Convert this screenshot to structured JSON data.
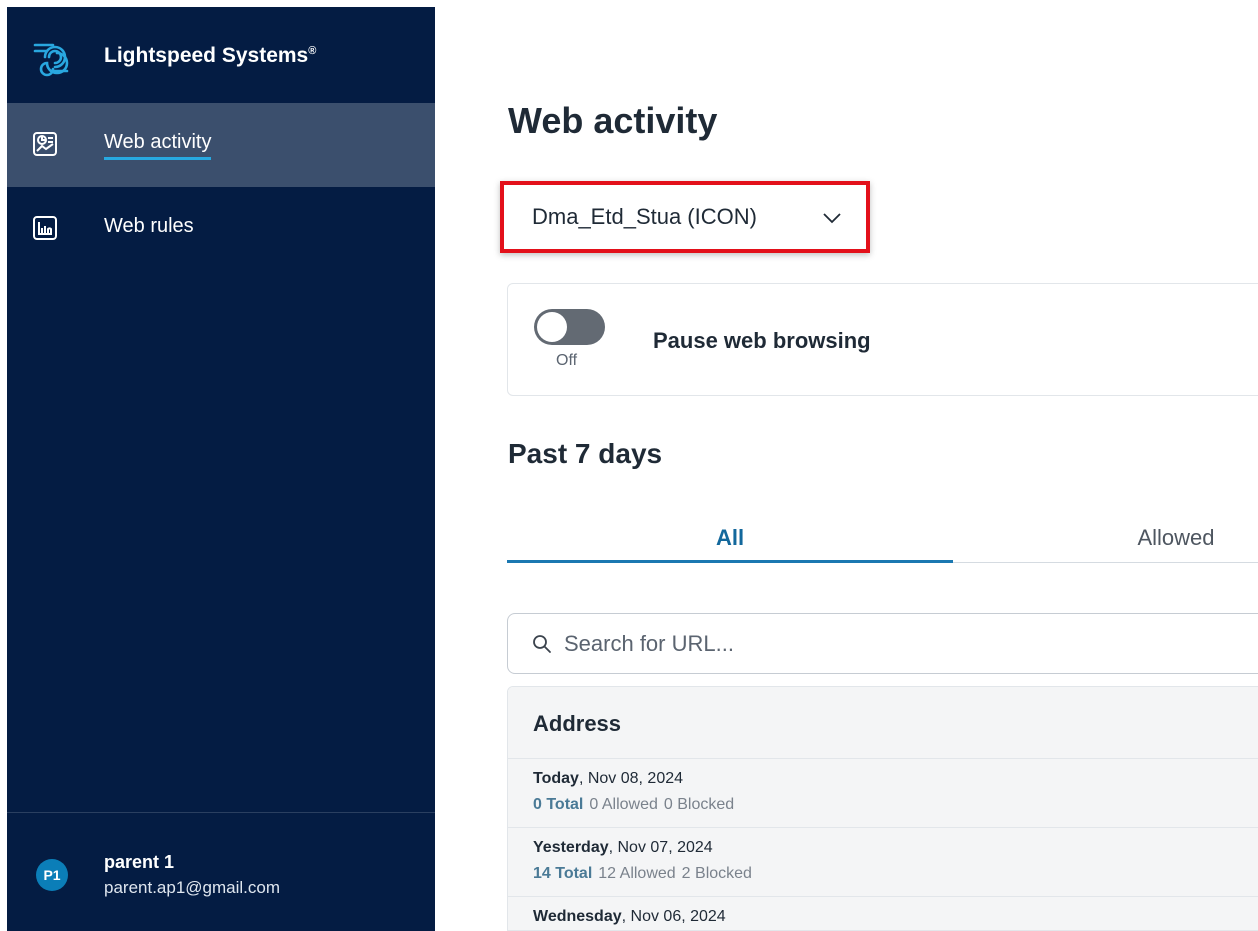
{
  "brand": {
    "name": "Lightspeed Systems",
    "mark": "®"
  },
  "nav": {
    "items": [
      {
        "label": "Web activity",
        "icon": "report-icon",
        "active": true
      },
      {
        "label": "Web rules",
        "icon": "chart-icon",
        "active": false
      }
    ]
  },
  "user": {
    "initials": "P1",
    "name": "parent 1",
    "email": "parent.ap1@gmail.com"
  },
  "main": {
    "title": "Web activity",
    "student_select": {
      "value": "Dma_Etd_Stua (ICON)"
    },
    "pause": {
      "label": "Pause web browsing",
      "state": "Off"
    },
    "section_title": "Past 7 days",
    "tabs": [
      {
        "label": "All",
        "active": true
      },
      {
        "label": "Allowed",
        "active": false
      }
    ],
    "search": {
      "placeholder": "Search for URL..."
    },
    "table": {
      "header": "Address",
      "rows": [
        {
          "day": "Today",
          "date": ", Nov 08, 2024",
          "total": "0 Total",
          "allowed": "0 Allowed",
          "blocked": "0 Blocked"
        },
        {
          "day": "Yesterday",
          "date": ", Nov 07, 2024",
          "total": "14 Total",
          "allowed": "12 Allowed",
          "blocked": "2 Blocked"
        },
        {
          "day": "Wednesday",
          "date": ", Nov 06, 2024",
          "total": "",
          "allowed": "",
          "blocked": ""
        }
      ]
    }
  },
  "colors": {
    "sidebar": "#041c43",
    "sidebar_active": "#3b4f6d",
    "accent": "#1b78b1",
    "highlight_border": "#e3101a"
  }
}
